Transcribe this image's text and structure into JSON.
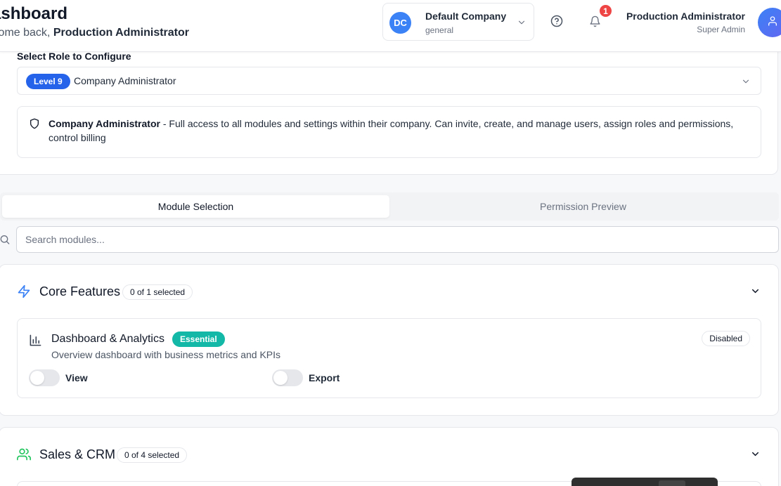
{
  "header": {
    "title": "ashboard",
    "welcome_prefix": "lcome back, ",
    "welcome_name": "Production Administrator",
    "company": {
      "initials": "DC",
      "name": "Default Company",
      "plan": "general"
    },
    "notification_count": "1",
    "user": {
      "name": "Production Administrator",
      "role": "Super Admin"
    }
  },
  "role": {
    "select_label": "Select Role to Configure",
    "level_badge": "Level 9",
    "selected_role": "Company Administrator",
    "description_title": "Company Administrator",
    "description_text": " - Full access to all modules and settings within their company. Can invite, create, and manage users, assign roles and permissions, control billing"
  },
  "tabs": [
    {
      "label": "Module Selection",
      "active": true
    },
    {
      "label": "Permission Preview",
      "active": false
    }
  ],
  "search": {
    "placeholder": "Search modules...",
    "value": ""
  },
  "sections": [
    {
      "title": "Core Features",
      "count": "0 of 1 selected",
      "icon": "zap-icon",
      "modules": [
        {
          "name": "Dashboard & Analytics",
          "badge": "Essential",
          "description": "Overview dashboard with business metrics and KPIs",
          "status": "Disabled",
          "icon": "bar-chart-icon",
          "permissions": [
            {
              "label": "View",
              "enabled": false
            },
            {
              "label": "Export",
              "enabled": false
            }
          ]
        }
      ]
    },
    {
      "title": "Sales & CRM",
      "count": "0 of 4 selected",
      "icon": "users-icon"
    }
  ],
  "colors": {
    "primary": "#3b82f6",
    "level_badge": "#2563eb",
    "essential_badge": "#14b8a6",
    "notification": "#ef4444",
    "sales_icon": "#22c55e"
  }
}
